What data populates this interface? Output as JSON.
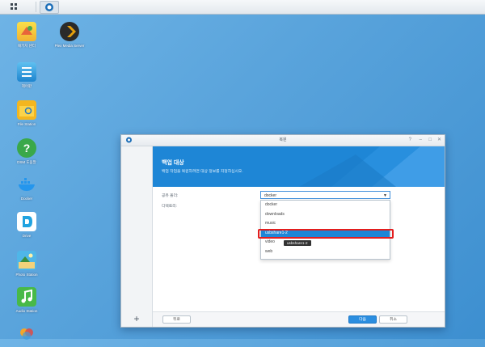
{
  "taskbar": {
    "main_icon": "grid-icon",
    "app_icon": "hyper-backup-icon"
  },
  "desktop": {
    "icons": [
      {
        "label": "패키지 센터",
        "icon": "package-center-icon"
      },
      {
        "label": "Plex Media Server",
        "icon": "plex-icon"
      },
      {
        "label": "제어판",
        "icon": "control-panel-icon"
      },
      {
        "label": "File Station",
        "icon": "file-station-icon"
      },
      {
        "label": "DSM 도움말",
        "icon": "help-icon"
      },
      {
        "label": "Docker",
        "icon": "docker-icon"
      },
      {
        "label": "Drive",
        "icon": "drive-icon"
      },
      {
        "label": "Photo Station",
        "icon": "photo-station-icon"
      },
      {
        "label": "Audio Station",
        "icon": "audio-station-icon"
      }
    ]
  },
  "window": {
    "title": "복원",
    "header_title": "백업 대상",
    "header_subtitle": "백업 작업을 복원하려면 대상 정보를 지정하십시오.",
    "shared_folder_label": "공유 폴더:",
    "directory_label": "디렉토리:",
    "selected_value": "docker",
    "options": [
      "docker",
      "downloads",
      "music",
      "usbshare1-2",
      "video",
      "web"
    ],
    "highlighted_option": "usbshare1-2",
    "tooltip": "usbshare1-2",
    "back_button": "뒤로",
    "next_button": "다음",
    "cancel_button": "취소"
  },
  "colors": {
    "accent": "#1e86d6",
    "highlight_box": "#e31e1e"
  }
}
